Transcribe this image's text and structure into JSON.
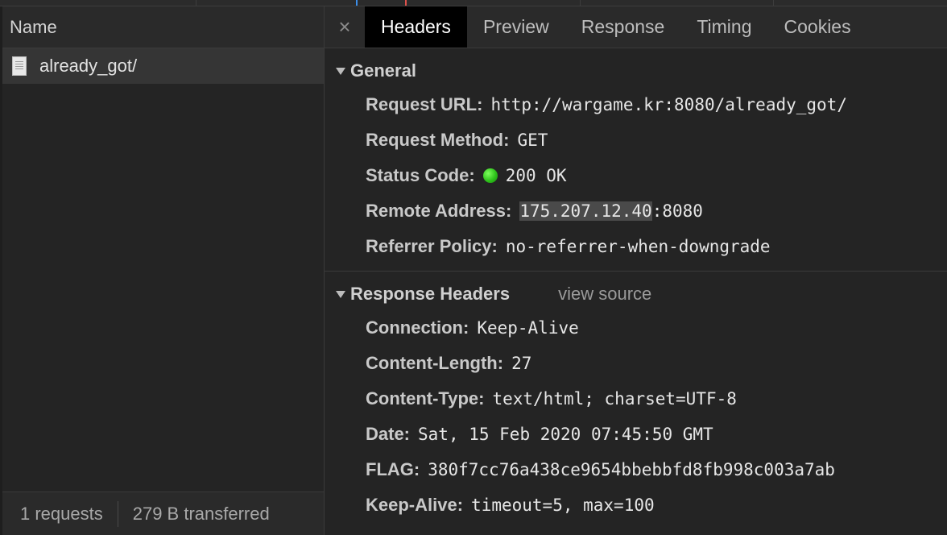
{
  "request_list": {
    "column_header": "Name",
    "items": [
      {
        "name": "already_got/"
      }
    ],
    "footer": {
      "requests": "1 requests",
      "transferred": "279 B transferred"
    }
  },
  "tabs": {
    "close_glyph": "×",
    "items": [
      "Headers",
      "Preview",
      "Response",
      "Timing",
      "Cookies"
    ],
    "active": "Headers"
  },
  "general": {
    "title": "General",
    "request_url": {
      "key": "Request URL:",
      "value": "http://wargame.kr:8080/already_got/"
    },
    "request_method": {
      "key": "Request Method:",
      "value": "GET"
    },
    "status_code": {
      "key": "Status Code:",
      "value": "200 OK",
      "status_color": "#2ec21b"
    },
    "remote_address": {
      "key": "Remote Address:",
      "ip": "175.207.12.40",
      "port": ":8080"
    },
    "referrer_policy": {
      "key": "Referrer Policy:",
      "value": "no-referrer-when-downgrade"
    }
  },
  "response_headers": {
    "title": "Response Headers",
    "view_source": "view source",
    "connection": {
      "key": "Connection:",
      "value": "Keep-Alive"
    },
    "content_length": {
      "key": "Content-Length:",
      "value": "27"
    },
    "content_type": {
      "key": "Content-Type:",
      "value": "text/html; charset=UTF-8"
    },
    "date": {
      "key": "Date:",
      "value": "Sat, 15 Feb 2020 07:45:50 GMT"
    },
    "flag": {
      "key": "FLAG:",
      "value": "380f7cc76a438ce9654bbebbfd8fb998c003a7ab"
    },
    "keep_alive": {
      "key": "Keep-Alive:",
      "value": "timeout=5, max=100"
    }
  },
  "icons": {
    "file": "document-icon",
    "collapse": "triangle-down-icon",
    "status": "status-dot-icon"
  }
}
